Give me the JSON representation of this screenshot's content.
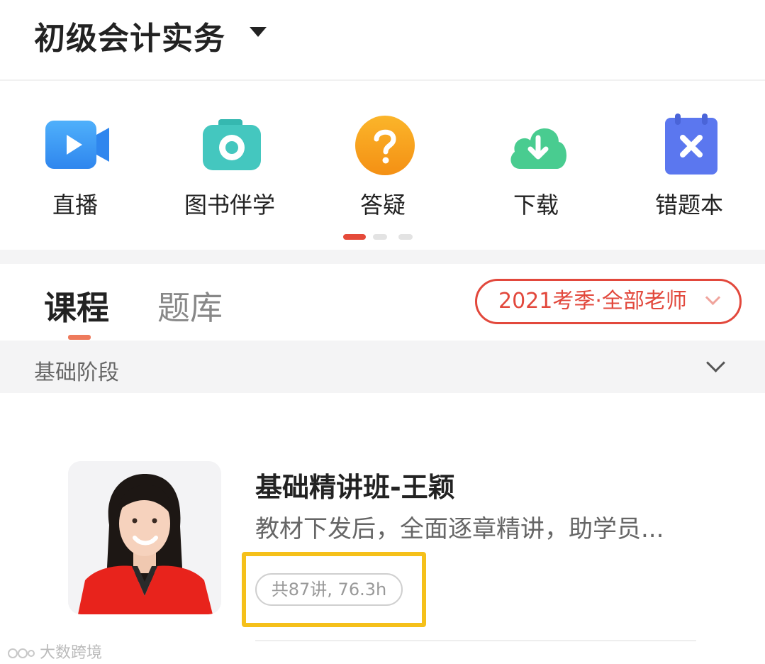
{
  "header": {
    "title": "初级会计实务"
  },
  "shortcuts": [
    {
      "label": "直播",
      "icon": "live-video-icon",
      "color": "#3d9bf5"
    },
    {
      "label": "图书伴学",
      "icon": "camera-icon",
      "color": "#3cc2bb"
    },
    {
      "label": "答疑",
      "icon": "question-icon",
      "color": "#f6a01a"
    },
    {
      "label": "下载",
      "icon": "download-cloud-icon",
      "color": "#42c98c"
    },
    {
      "label": "错题本",
      "icon": "wrong-notebook-icon",
      "color": "#5a76ef"
    }
  ],
  "pager": {
    "pages": 3,
    "active": 0,
    "active_color": "#e54a3a"
  },
  "tabs": {
    "courses": "课程",
    "questions": "题库"
  },
  "filter": {
    "label": "2021考季·全部老师"
  },
  "stage": {
    "label": "基础阶段"
  },
  "course": {
    "title": "基础精讲班-王颖",
    "description": "教材下发后，全面逐章精讲，助学员...",
    "meta": "共87讲, 76.3h"
  },
  "watermark": {
    "text": "大数跨境"
  }
}
